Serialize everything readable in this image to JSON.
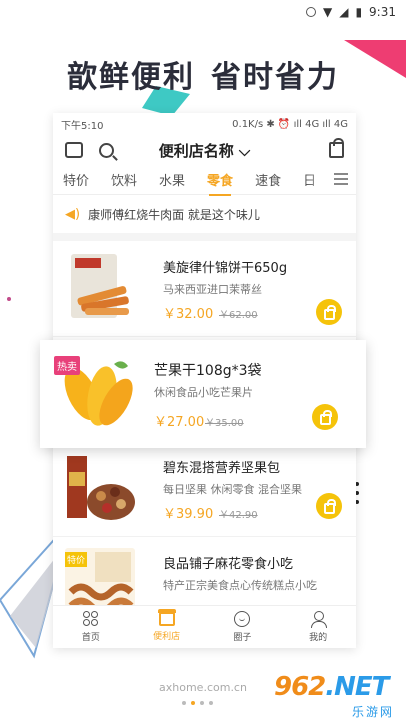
{
  "system_bar": {
    "time": "9:31"
  },
  "headline": {
    "part1": "歆鲜便利",
    "part2": "省时省力"
  },
  "phone": {
    "status_time": "下午5:10",
    "status_right": "0.1K/s ✱ ⏰ ıll 4G ıll 4G",
    "store_name": "便利店名称",
    "tabs": [
      "特价",
      "饮料",
      "水果",
      "零食",
      "速食",
      "日"
    ],
    "active_tab_index": 3,
    "notice": "康师傅红烧牛肉面 就是这个味儿",
    "products": [
      {
        "name": "美旋律什锦饼干650g",
        "desc": "马来西亚进口茉蒂丝",
        "price": "￥32.00",
        "old_price": "￥62.00",
        "badge": ""
      },
      {
        "name": "碧东混搭营养坚果包",
        "desc": "每日坚果 休闲零食 混合坚果",
        "price": "￥39.90",
        "old_price": "￥42.90",
        "badge": ""
      },
      {
        "name": "良品铺子麻花零食小吃",
        "desc": "特产正宗美食点心传统糕点小吃",
        "price": "",
        "old_price": "",
        "badge": "特价"
      }
    ],
    "featured": {
      "badge": "热卖",
      "name": "芒果干108g*3袋",
      "desc": "休闲食品小吃芒果片",
      "price": "￥27.00",
      "old_price": "￥35.00"
    },
    "nav": [
      {
        "label": "首页",
        "icon": "home-icon"
      },
      {
        "label": "便利店",
        "icon": "store-icon"
      },
      {
        "label": "圈子",
        "icon": "circle-icon"
      },
      {
        "label": "我的",
        "icon": "profile-icon"
      }
    ],
    "active_nav_index": 1
  },
  "footer": {
    "url": "axhome.com.cn"
  },
  "watermark": {
    "num1": "962",
    "num2": ".NET",
    "cn": "乐游网"
  },
  "colors": {
    "accent": "#f5a623",
    "cart": "#f5c30a",
    "hot": "#e8407a",
    "headline": "#2b2d3a",
    "teal": "#3ec9c4",
    "pink": "#ee3d72"
  }
}
